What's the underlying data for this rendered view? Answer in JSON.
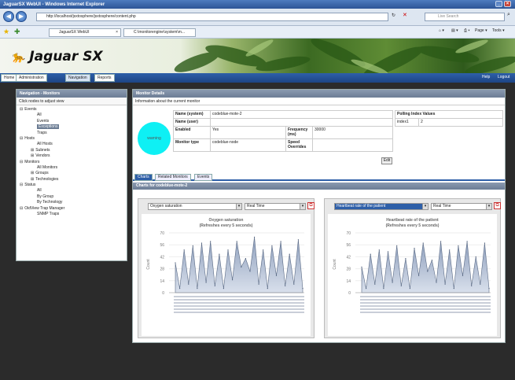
{
  "window": {
    "title": "JaguarSX WebUI - Windows Internet Explorer"
  },
  "browser": {
    "url": "http://localhost/jsxtosphere/jsxtosphere/content.php",
    "search_placeholder": "Live Search",
    "tab1": "JaguarSX WebUI",
    "tab2": "C:\\monitorengine\\system\\m...",
    "page_menu": "Page",
    "tools_menu": "Tools"
  },
  "app": {
    "logo": "Jaguar SX",
    "nav": [
      "Home",
      "Administration",
      "Navigation",
      "Reports"
    ],
    "help": "Help",
    "logout": "Logout"
  },
  "sidebar": {
    "title": "Navigation - Monitors",
    "hint": "Click nodes to adjust view",
    "tree": [
      {
        "label": "Events",
        "level": 0,
        "toggle": "⊟"
      },
      {
        "label": "All",
        "level": 1
      },
      {
        "label": "Events",
        "level": 1
      },
      {
        "label": "Exceptions",
        "level": 1,
        "selected": true
      },
      {
        "label": "Traps",
        "level": 1
      },
      {
        "label": "Hosts",
        "level": 0,
        "toggle": "⊟"
      },
      {
        "label": "All Hosts",
        "level": 1
      },
      {
        "label": "Subnets",
        "level": 1,
        "toggle": "⊞"
      },
      {
        "label": "Vendors",
        "level": 1,
        "toggle": "⊞"
      },
      {
        "label": "Monitors",
        "level": 0,
        "toggle": "⊟"
      },
      {
        "label": "All Monitors",
        "level": 1
      },
      {
        "label": "Groups",
        "level": 1,
        "toggle": "⊞"
      },
      {
        "label": "Technologies",
        "level": 1,
        "toggle": "⊞"
      },
      {
        "label": "Status",
        "level": 0,
        "toggle": "⊟"
      },
      {
        "label": "All",
        "level": 1
      },
      {
        "label": "By Group",
        "level": 1
      },
      {
        "label": "By Technology",
        "level": 1
      },
      {
        "label": "OidView Trap Manager",
        "level": 0,
        "toggle": "⊟"
      },
      {
        "label": "SNMP Traps",
        "level": 1
      }
    ]
  },
  "details": {
    "title": "Monitor Details",
    "info": "Information about the current monitor",
    "status": "warning",
    "name_system_label": "Name (system)",
    "name_system": "codeblue-mote-2",
    "name_user_label": "Name (user)",
    "name_user": "",
    "enabled_label": "Enabled",
    "enabled": "Yes",
    "frequency_label": "Frequency (ms)",
    "frequency": "30000",
    "type_label": "Monitor type",
    "type": "codeblue-node",
    "speed_label": "Speed Overrides",
    "speed": "",
    "polling_title": "Polling Index Values",
    "polling_index_label": "index1",
    "polling_index_value": "2",
    "edit": "Edit"
  },
  "subtabs": [
    "Charts",
    "Related Monitors",
    "Events"
  ],
  "charts_header": "Charts for codeblue-mote-2",
  "charts": [
    {
      "metric_select": "Oxygen saturation",
      "range_select": "Real Time",
      "title": "Oxygen saturation",
      "subtitle": "(Refreshes every 5 seconds)",
      "ylabel": "Count",
      "yticks": [
        "70",
        "56",
        "42",
        "28",
        "14",
        "0"
      ]
    },
    {
      "metric_select": "Heartbeat rate of the patient",
      "range_select": "Real Time",
      "title": "Heartbeat rate of the patient",
      "subtitle": "(Refreshes every 5 seconds)",
      "ylabel": "Count",
      "yticks": [
        "70",
        "56",
        "42",
        "28",
        "14",
        "0"
      ]
    }
  ],
  "chart_data": [
    {
      "type": "area",
      "title": "Oxygen saturation",
      "ylabel": "Count",
      "ylim": [
        0,
        70
      ],
      "values": [
        35,
        5,
        50,
        10,
        55,
        5,
        58,
        12,
        60,
        8,
        45,
        5,
        50,
        15,
        60,
        30,
        40,
        25,
        65,
        10,
        50,
        5,
        55,
        20,
        60,
        8,
        45,
        10,
        62,
        5
      ]
    },
    {
      "type": "area",
      "title": "Heartbeat rate of the patient",
      "ylabel": "Count",
      "ylim": [
        0,
        70
      ],
      "values": [
        30,
        5,
        45,
        10,
        50,
        5,
        48,
        12,
        55,
        8,
        40,
        5,
        52,
        20,
        58,
        25,
        38,
        12,
        60,
        10,
        50,
        5,
        55,
        20,
        60,
        8,
        42,
        10,
        58,
        5
      ]
    }
  ]
}
